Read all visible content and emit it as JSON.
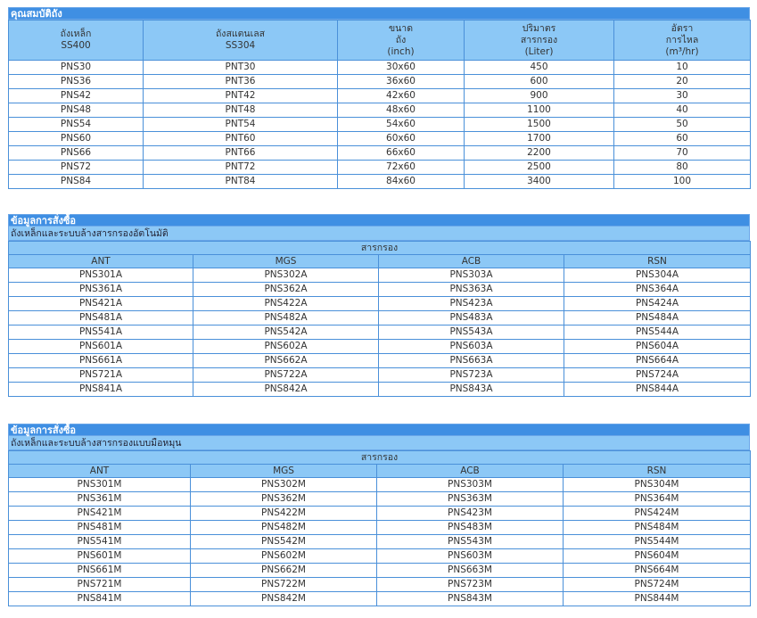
{
  "spec": {
    "title": "คุณสมบัติถัง",
    "headers": [
      [
        "ถังเหล็ก",
        "SS400"
      ],
      [
        "ถังสแตนเลส",
        "SS304"
      ],
      [
        "ขนาด",
        "ถัง",
        "(inch)"
      ],
      [
        "ปริมาตร",
        "สารกรอง",
        "(Liter)"
      ],
      [
        "อัตรา",
        "การไหล",
        "(m³/hr)"
      ]
    ],
    "rows": [
      [
        "PNS30",
        "PNT30",
        "30x60",
        "450",
        "10"
      ],
      [
        "PNS36",
        "PNT36",
        "36x60",
        "600",
        "20"
      ],
      [
        "PNS42",
        "PNT42",
        "42x60",
        "900",
        "30"
      ],
      [
        "PNS48",
        "PNT48",
        "48x60",
        "1100",
        "40"
      ],
      [
        "PNS54",
        "PNT54",
        "54x60",
        "1500",
        "50"
      ],
      [
        "PNS60",
        "PNT60",
        "60x60",
        "1700",
        "60"
      ],
      [
        "PNS66",
        "PNT66",
        "66x60",
        "2200",
        "70"
      ],
      [
        "PNS72",
        "PNT72",
        "72x60",
        "2500",
        "80"
      ],
      [
        "PNS84",
        "PNT84",
        "84x60",
        "3400",
        "100"
      ]
    ]
  },
  "order_auto": {
    "title": "ข้อมูลการสั่งซื้อ",
    "subtitle": "ถังเหล็กและระบบล้างสารกรองอัตโนมัติ",
    "group": "สารกรอง",
    "columns": [
      "ANT",
      "MGS",
      "ACB",
      "RSN"
    ],
    "rows": [
      [
        "PNS301A",
        "PNS302A",
        "PNS303A",
        "PNS304A"
      ],
      [
        "PNS361A",
        "PNS362A",
        "PNS363A",
        "PNS364A"
      ],
      [
        "PNS421A",
        "PNS422A",
        "PNS423A",
        "PNS424A"
      ],
      [
        "PNS481A",
        "PNS482A",
        "PNS483A",
        "PNS484A"
      ],
      [
        "PNS541A",
        "PNS542A",
        "PNS543A",
        "PNS544A"
      ],
      [
        "PNS601A",
        "PNS602A",
        "PNS603A",
        "PNS604A"
      ],
      [
        "PNS661A",
        "PNS662A",
        "PNS663A",
        "PNS664A"
      ],
      [
        "PNS721A",
        "PNS722A",
        "PNS723A",
        "PNS724A"
      ],
      [
        "PNS841A",
        "PNS842A",
        "PNS843A",
        "PNS844A"
      ]
    ]
  },
  "order_manual": {
    "title": "ข้อมูลการสั่งซื้อ",
    "subtitle": "ถังเหล็กและระบบล้างสารกรองแบบมือหมุน",
    "group": "สารกรอง",
    "columns": [
      "ANT",
      "MGS",
      "ACB",
      "RSN"
    ],
    "rows": [
      [
        "PNS301M",
        "PNS302M",
        "PNS303M",
        "PNS304M"
      ],
      [
        "PNS361M",
        "PNS362M",
        "PNS363M",
        "PNS364M"
      ],
      [
        "PNS421M",
        "PNS422M",
        "PNS423M",
        "PNS424M"
      ],
      [
        "PNS481M",
        "PNS482M",
        "PNS483M",
        "PNS484M"
      ],
      [
        "PNS541M",
        "PNS542M",
        "PNS543M",
        "PNS544M"
      ],
      [
        "PNS601M",
        "PNS602M",
        "PNS603M",
        "PNS604M"
      ],
      [
        "PNS661M",
        "PNS662M",
        "PNS663M",
        "PNS664M"
      ],
      [
        "PNS721M",
        "PNS722M",
        "PNS723M",
        "PNS724M"
      ],
      [
        "PNS841M",
        "PNS842M",
        "PNS843M",
        "PNS844M"
      ]
    ]
  }
}
